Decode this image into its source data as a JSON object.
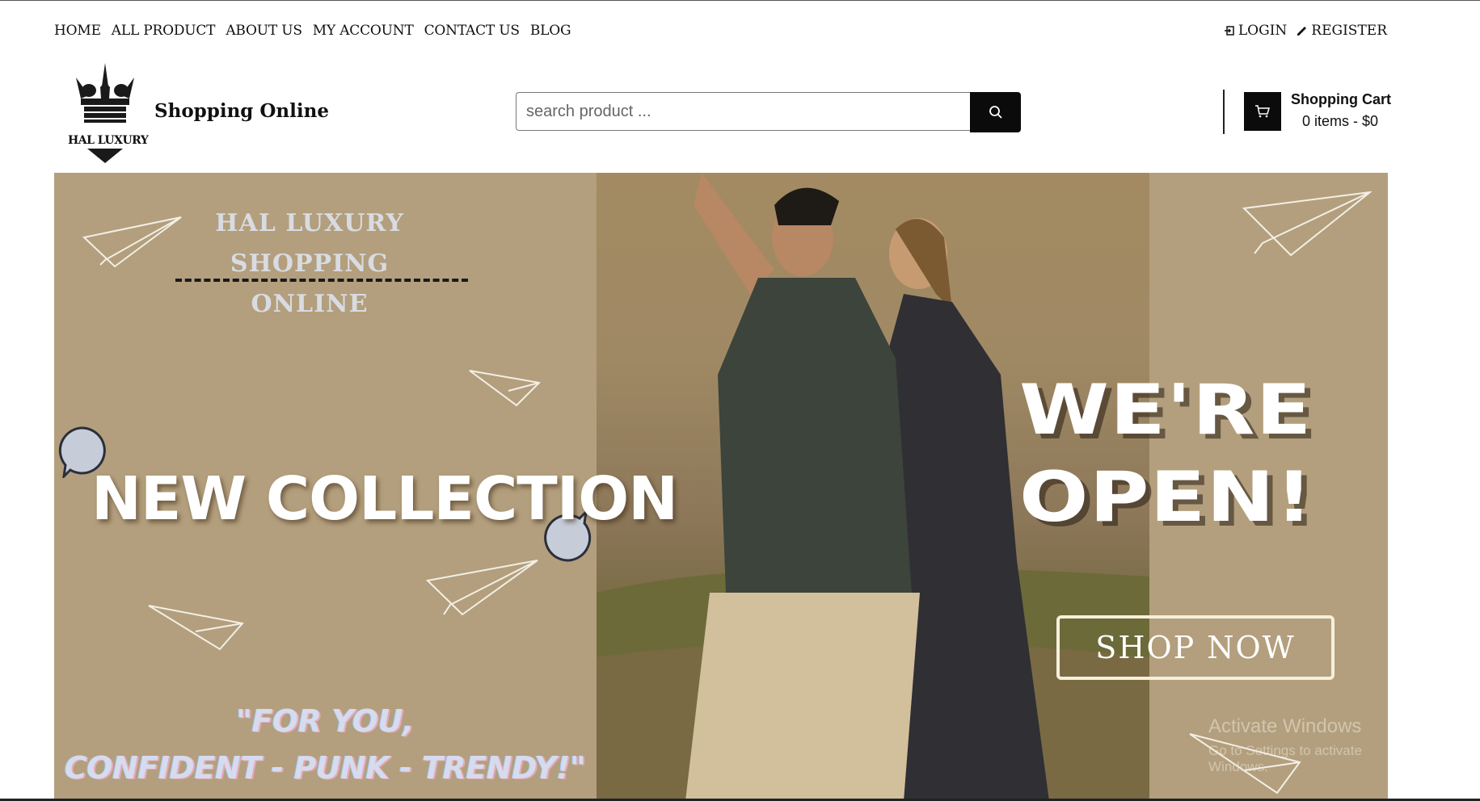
{
  "nav": {
    "items": [
      "HOME",
      "ALL PRODUCT",
      "ABOUT US",
      "MY ACCOUNT",
      "CONTACT US",
      "BLOG"
    ]
  },
  "auth": {
    "login": "LOGIN",
    "register": "REGISTER"
  },
  "header": {
    "logo_text": "HAL LUXURY",
    "brand": "Shopping Online",
    "search_placeholder": "search product ..."
  },
  "cart": {
    "title": "Shopping Cart",
    "summary": "0 items - $0"
  },
  "banner": {
    "brand_line1": "HAL LUXURY",
    "brand_line2": "SHOPPING ONLINE",
    "headline": "NEW COLLECTION",
    "slogan_line1": "\"FOR YOU,",
    "slogan_line2": "CONFIDENT - PUNK - TRENDY!\"",
    "open_line1": "WE'RE",
    "open_line2": "OPEN!",
    "cta": "SHOP NOW"
  },
  "watermark": {
    "line1": "Activate Windows",
    "line2": "Go to Settings to activate Windows."
  },
  "colors": {
    "banner_bg": "#b39f7d",
    "button_bg": "#0b0b0b"
  }
}
